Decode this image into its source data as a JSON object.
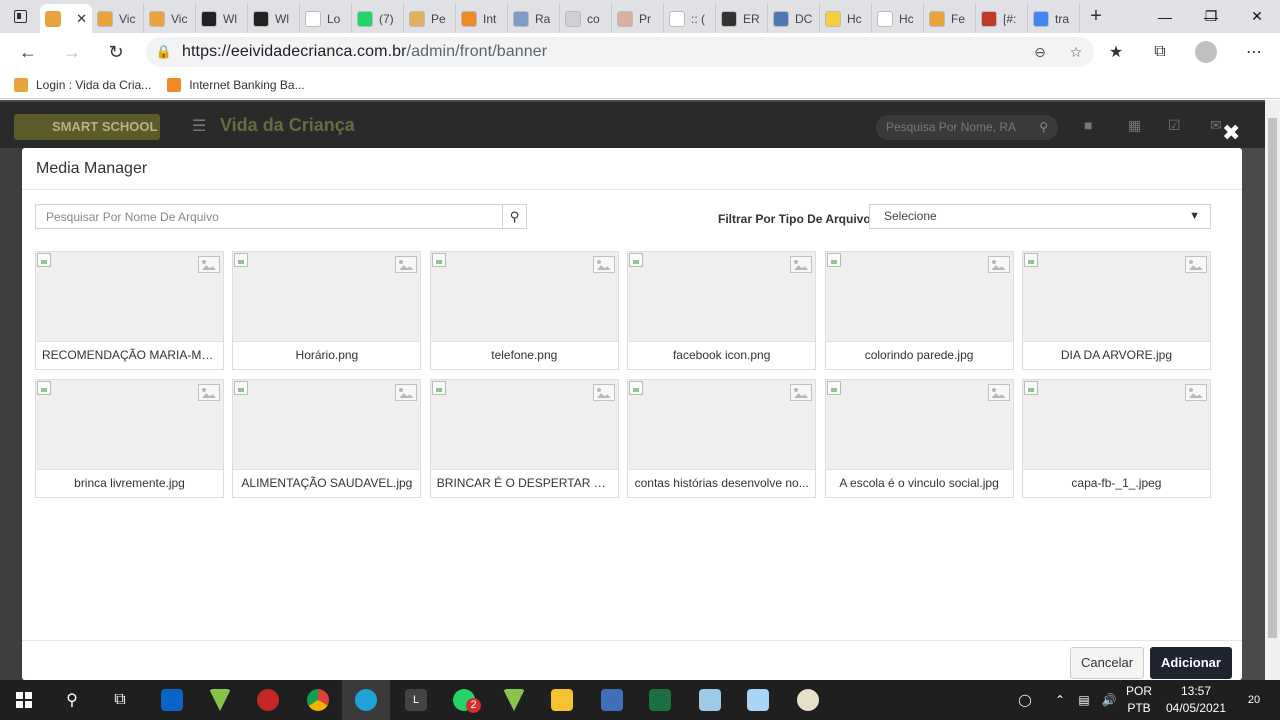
{
  "browser": {
    "active_tab_close": "✕",
    "tabs": [
      {
        "label": "Vic",
        "color": "#e8a33d"
      },
      {
        "label": "Vic",
        "color": "#e8a33d"
      },
      {
        "label": "Wl",
        "color": "#222222"
      },
      {
        "label": "Wl",
        "color": "#222222"
      },
      {
        "label": "Lo",
        "color": "#ffffff"
      },
      {
        "label": "(7)",
        "color": "#25d366"
      },
      {
        "label": "Pe",
        "color": "#e0b060"
      },
      {
        "label": "Int",
        "color": "#f08a24"
      },
      {
        "label": "Ra",
        "color": "#7a9cc6"
      },
      {
        "label": "co",
        "color": "#cfcfcf"
      },
      {
        "label": "Pr",
        "color": "#d8b0a0"
      },
      {
        "label": ":: (",
        "color": "#ffffff"
      },
      {
        "label": "ER",
        "color": "#333333"
      },
      {
        "label": "DC",
        "color": "#4a7ab0"
      },
      {
        "label": "Hc",
        "color": "#f4d03f"
      },
      {
        "label": "Hc",
        "color": "#ffffff"
      },
      {
        "label": "Fe",
        "color": "#e8a33d"
      },
      {
        "label": "[#:",
        "color": "#c0392b"
      },
      {
        "label": "tra",
        "color": "#4285f4"
      }
    ],
    "url_host": "https://eeividadecrianca.com.br",
    "url_path": "/admin/front/banner",
    "bookmarks": [
      {
        "label": "Login : Vida da Cria...",
        "color": "#e8a33d"
      },
      {
        "label": "Internet Banking Ba...",
        "color": "#f08a24"
      }
    ]
  },
  "app": {
    "brand": "SMART SCHOOL",
    "school_name": "Vida da Criança",
    "search_placeholder": "Pesquisa Por Nome, RA"
  },
  "modal": {
    "title": "Media Manager",
    "close": "✖",
    "search_placeholder": "Pesquisar Por Nome De Arquivo",
    "filter_label": "Filtrar Por Tipo De Arquivo",
    "filter_value": "Selecione",
    "files": [
      "RECOMENDAÇÃO MARIA-MAR...",
      "Horário.png",
      "telefone.png",
      "facebook icon.png",
      "colorindo parede.jpg",
      "DIA DA ARVORE.jpg",
      "brinca livremente.jpg",
      "ALIMENTAÇÃO SAUDAVEL.jpg",
      "BRINCAR É O DESPERTAR PAR...",
      "contas histórias desenvolve no...",
      "A escola é o vinculo social.jpg",
      "capa-fb-_1_.jpeg"
    ],
    "cancel_label": "Cancelar",
    "add_label": "Adicionar"
  },
  "taskbar": {
    "lang_line1": "POR",
    "lang_line2": "PTB",
    "time": "13:57",
    "date": "04/05/2021",
    "whatsapp_badge": "2",
    "notif_count": "20"
  },
  "colors": {
    "modal_primary": "#1f2430",
    "page_overlay": "#4a4a4a",
    "taskbar": "#1f1f1f"
  }
}
